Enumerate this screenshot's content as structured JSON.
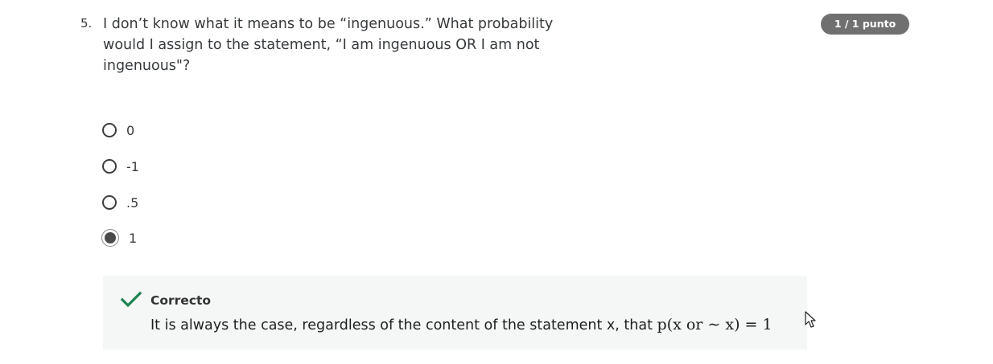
{
  "question": {
    "number": "5.",
    "text": "I don’t know what it means to be “ingenuous.” What probability would I assign to the statement, “I am ingenuous OR I am not ingenuous\"?",
    "score_badge": "1 / 1 punto"
  },
  "options": [
    {
      "label": "0",
      "selected": false
    },
    {
      "label": "-1",
      "selected": false
    },
    {
      "label": ".5",
      "selected": false
    },
    {
      "label": "1",
      "selected": true
    }
  ],
  "feedback": {
    "status": "Correcto",
    "text": "It is always the case, regardless of the content of the statement x, that",
    "formula": "p(x or ∼ x) = 1",
    "status_color": "#1f8354"
  },
  "icons": {
    "feedback_icon": "check-icon",
    "pointer": "mouse-cursor-icon"
  }
}
